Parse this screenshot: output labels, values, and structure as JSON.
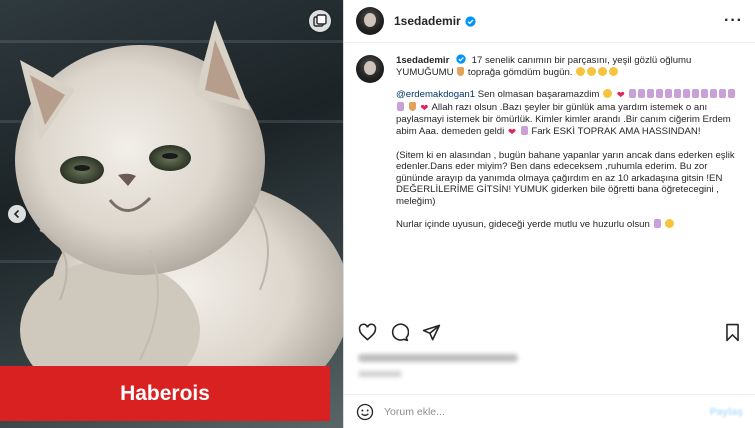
{
  "watermark": {
    "text": "Haberois"
  },
  "post": {
    "username": "1sedademir",
    "more_icon": "more-horizontal-icon"
  },
  "caption": {
    "username": "1sedademir",
    "line1": "17 senelik canımın bir parçasını, yeşil gözlü oğlumu YUMUĞUMU",
    "line1b": "toprağa gömdüm bugün.",
    "mention": "@erdemakdogan1",
    "p2a": "Sen olmasan başaramazdim",
    "p2b": "Allah razı olsun .Bazı şeyler bir günlük ama yardım istemek o anı paylasmayi istemek bir ömürlük. Kimler kimler arandı .Bir canım ciğerim Erdem abim Aaa. demeden geldi",
    "p2c": "Fark ESKİ TOPRAK AMA HASSINDAN!",
    "p3": "(Sitem ki en alasından , bugün bahane yapanlar yarın ancak dans ederken eşlik edenler.Dans eder miyim? Ben dans edeceksem ,ruhumla ederim. Bu zor gününde arayıp da yanımda olmaya çağırdım en az 10 arkadaşına gitsin !EN DEĞERLİLERİME GİTSİN! YUMUK giderken bile öğretti bana öğretecegini , meleğim)",
    "p4": "Nurlar içinde uyusun, gideceği yerde mutlu ve huzurlu olsun"
  },
  "actions": {
    "like_icon": "heart-icon",
    "comment_icon": "comment-icon",
    "share_icon": "send-icon",
    "save_icon": "bookmark-icon"
  },
  "comment": {
    "placeholder": "Yorum ekle...",
    "post_label": "Paylaş"
  },
  "colors": {
    "watermark_bg": "#d92121",
    "verified": "#0095f6",
    "mention": "#00376b"
  }
}
